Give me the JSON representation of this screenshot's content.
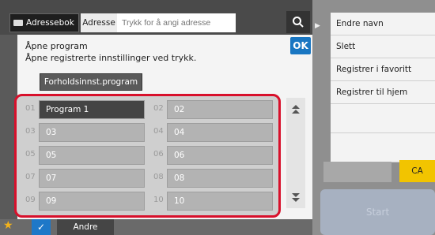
{
  "topbar": {
    "book_label": "Adressebok",
    "address_tab": "Adresse",
    "address_placeholder": "Trykk for å angi adresse"
  },
  "dialog": {
    "title": "Åpne program",
    "subtitle": "Åpne registrerte innstillinger ved trykk.",
    "ok_label": "OK",
    "program_button": "Forholdsinnst.program"
  },
  "programs": [
    {
      "num": "01",
      "label": "Program 1",
      "selected": true
    },
    {
      "num": "02",
      "label": "02"
    },
    {
      "num": "03",
      "label": "03"
    },
    {
      "num": "04",
      "label": "04"
    },
    {
      "num": "05",
      "label": "05"
    },
    {
      "num": "06",
      "label": "06"
    },
    {
      "num": "07",
      "label": "07"
    },
    {
      "num": "08",
      "label": "08"
    },
    {
      "num": "09",
      "label": "09"
    },
    {
      "num": "10",
      "label": "10"
    }
  ],
  "bottom": {
    "other_label": "Andre"
  },
  "side_menu": {
    "items": [
      "Endre navn",
      "Slett",
      "Registrer i favoritt",
      "Registrer til hjem"
    ]
  },
  "right": {
    "ca_label": "CA",
    "start_label": "Start"
  },
  "colors": {
    "highlight": "#d8102b",
    "ok": "#1976c2",
    "ca": "#f2c400"
  }
}
